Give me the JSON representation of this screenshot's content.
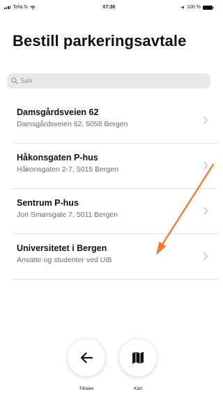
{
  "status_bar": {
    "carrier": "Telia N",
    "time": "07:36",
    "battery": "100 %"
  },
  "page": {
    "title": "Bestill parkeringsavtale"
  },
  "search": {
    "placeholder": "Søk"
  },
  "locations": [
    {
      "name": "Damsgårdsveien 62",
      "address": "Damsgårdsveien 62, 5058 Bergen"
    },
    {
      "name": "Håkonsgaten P-hus",
      "address": "Håkonsgaten 2-7, 5015 Bergen"
    },
    {
      "name": "Sentrum P-hus",
      "address": "Jon Smørsgate 7, 5011 Bergen"
    },
    {
      "name": "Universitetet i Bergen",
      "address": "Ansatte og studenter ved UiB"
    }
  ],
  "bottom_nav": {
    "back_label": "Tilbake",
    "map_label": "Kart"
  },
  "colors": {
    "annotation_arrow": "#f07d2c",
    "search_background": "#e9e9ec",
    "secondary_text": "#6d6d72"
  },
  "icons": {
    "search": "magnifier-icon",
    "chevron": "chevron-right-icon",
    "back": "arrow-left-icon",
    "map": "map-icon"
  }
}
